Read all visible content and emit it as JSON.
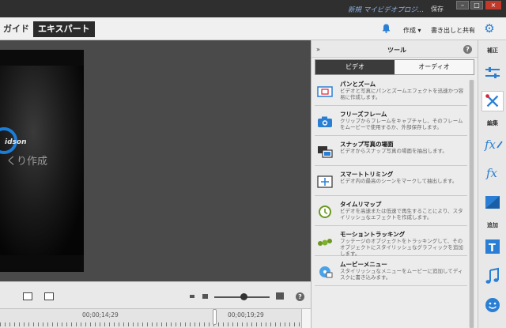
{
  "titlebar": {
    "project_name": "新規 マイビデオプロジ…",
    "save_label": "保存",
    "minimize_glyph": "–",
    "maximize_glyph": "□",
    "close_glyph": "×"
  },
  "toolbar": {
    "modes": {
      "guide": "ガイド",
      "expert": "エキスパート"
    },
    "active_mode": "expert",
    "create_label": "作成 ▾",
    "export_label": "書き出しと共有",
    "icons": [
      "bell-icon",
      "gear-icon"
    ]
  },
  "monitor": {
    "video_brand": "idson",
    "video_caption": "くり作成",
    "controls": {
      "icons": [
        "render-preview-icon",
        "fullscreen-icon"
      ],
      "help_glyph": "?"
    }
  },
  "timeline": {
    "timecodes": [
      "00;00;14;29",
      "00;00;19;29"
    ]
  },
  "tools_panel": {
    "title": "ツール",
    "collapse_glyph": "»",
    "help_glyph": "?",
    "tabs": [
      {
        "label": "ビデオ",
        "active": true
      },
      {
        "label": "オーディオ",
        "active": false
      }
    ],
    "items": [
      {
        "name": "パンとズーム",
        "desc": "ビデオと写真にパンとズームエフェクトを迅速かつ容易に作成します。",
        "icon": "pan-zoom-icon"
      },
      {
        "name": "フリーズフレーム",
        "desc": "クリップからフレームをキャプチャし、そのフレームをムービーで使用するか、外部保存します。",
        "icon": "camera-icon"
      },
      {
        "name": "スナップ写真の場面",
        "desc": "ビデオからスナップ写真の場面を抽出します。",
        "icon": "snapshot-icon"
      },
      {
        "name": "スマートトリミング",
        "desc": "ビデオ内の最高のシーンをマークして抽出します。",
        "icon": "smart-trim-icon"
      },
      {
        "name": "タイムリマップ",
        "desc": "ビデオを高速または低速で再生することにより、スタイリッシュなエフェクトを作成します。",
        "icon": "time-remap-icon"
      },
      {
        "name": "モーショントラッキング",
        "desc": "フッテージのオブジェクトをトラッキングして、そのオブジェクトにスタイリッシュなグラフィックを追加します。",
        "icon": "motion-tracking-icon"
      },
      {
        "name": "ムービーメニュー",
        "desc": "スタイリッシュなメニューをムービーに追加してディスクに書き込みます。",
        "icon": "disc-menu-icon"
      }
    ]
  },
  "sidebar": {
    "sections": {
      "adjust": "補正",
      "edit": "編集",
      "add": "追加"
    },
    "icons": [
      "adjust-sliders-icon",
      "tools-icon",
      "fx-edit-icon",
      "fx-icon",
      "transition-icon",
      "title-icon",
      "music-icon",
      "graphics-icon"
    ],
    "active": "tools-icon"
  },
  "colors": {
    "accent_blue": "#2a7fd4",
    "dark_bg": "#2b2b2b",
    "panel_bg": "#ececec",
    "project_name_color": "#8fb4e6"
  }
}
